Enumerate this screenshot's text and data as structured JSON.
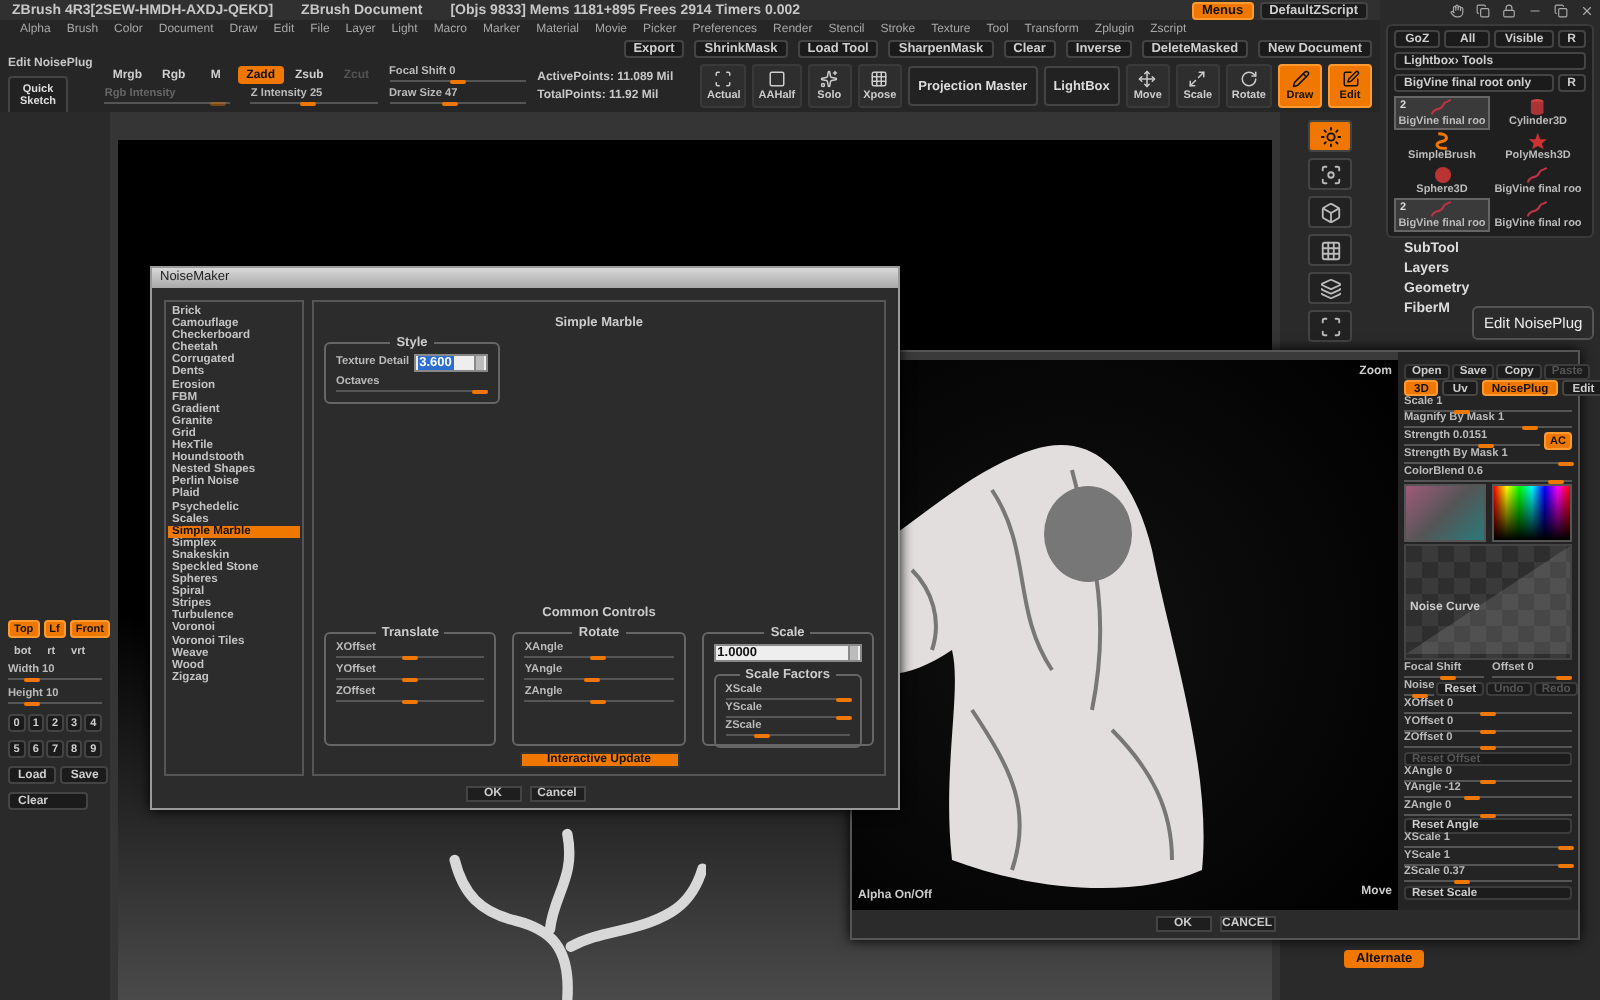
{
  "title_bar": {
    "app": "ZBrush 4R3[2SEW-HMDH-AXDJ-QEKD]",
    "document": "ZBrush Document",
    "stats": "[Objs 9833] Mems 1181+895 Frees 2914 Timers 0.002",
    "buttons": [
      {
        "label": "Menus",
        "selected": true
      },
      {
        "label": "DefaultZScript",
        "selected": false
      }
    ]
  },
  "menu": [
    "Alpha",
    "Brush",
    "Color",
    "Document",
    "Draw",
    "Edit",
    "File",
    "Layer",
    "Light",
    "Macro",
    "Marker",
    "Material",
    "Movie",
    "Picker",
    "Preferences",
    "Render",
    "Stencil",
    "Stroke",
    "Texture",
    "Tool",
    "Transform",
    "Zplugin",
    "Zscript"
  ],
  "toolbar": [
    "Export",
    "ShrinkMask",
    "Load Tool",
    "SharpenMask",
    "Clear",
    "Inverse",
    "DeleteMasked",
    "New Document"
  ],
  "shelf": {
    "edit_label": "Edit NoisePlug",
    "quick_sketch": "Quick Sketch",
    "modes": [
      {
        "label": "Mrgb",
        "selected": false,
        "disabled": false
      },
      {
        "label": "Rgb",
        "selected": false,
        "disabled": false
      },
      {
        "label": "M",
        "selected": false,
        "disabled": false
      },
      {
        "label": "Zadd",
        "selected": true,
        "disabled": false
      },
      {
        "label": "Zsub",
        "selected": false,
        "disabled": false
      },
      {
        "label": "Zcut",
        "selected": false,
        "disabled": true
      }
    ],
    "sliders": [
      {
        "label": "Rgb Intensity",
        "level": 0.9,
        "disabled": true
      },
      {
        "label": "Z Intensity 25",
        "level": 0.45,
        "disabled": false
      },
      {
        "label": "Focal Shift 0",
        "level": 0.5,
        "disabled": false
      },
      {
        "label": "Draw Size 47",
        "level": 0.45,
        "disabled": false
      }
    ],
    "points": [
      "ActivePoints: 11.089 Mil",
      "TotalPoints: 11.92 Mil"
    ],
    "tools": [
      {
        "label": "Actual",
        "kind": "icon",
        "selected": false
      },
      {
        "label": "AAHalf",
        "kind": "icon",
        "selected": false
      },
      {
        "label": "Solo",
        "kind": "icon",
        "selected": false
      },
      {
        "label": "Xpose",
        "kind": "icon",
        "selected": false
      },
      {
        "label": "Projection Master",
        "kind": "text",
        "selected": false
      },
      {
        "label": "LightBox",
        "kind": "text",
        "selected": false
      },
      {
        "label": "Move",
        "kind": "icon",
        "selected": false
      },
      {
        "label": "Scale",
        "kind": "icon",
        "selected": false
      },
      {
        "label": "Rotate",
        "kind": "icon",
        "selected": false
      },
      {
        "label": "Draw",
        "kind": "icon",
        "selected": true
      },
      {
        "label": "Edit",
        "kind": "icon",
        "selected": true
      }
    ]
  },
  "left_strip": {
    "views": [
      {
        "label": "Top",
        "selected": true
      },
      {
        "label": "Lf",
        "selected": true
      },
      {
        "label": "Front",
        "selected": true
      }
    ],
    "views2": [
      "bot",
      "rt",
      "vrt"
    ],
    "sliders": [
      {
        "label": "Width 10",
        "level": 0.25
      },
      {
        "label": "Height 10",
        "level": 0.25
      }
    ],
    "digits": [
      "0",
      "1",
      "2",
      "3",
      "4",
      "5",
      "6",
      "7",
      "8",
      "9"
    ],
    "actions": [
      "Load",
      "Save"
    ],
    "clear": "Clear"
  },
  "right_shelf": [
    {
      "selected": true
    },
    {
      "selected": false
    },
    {
      "selected": false
    },
    {
      "selected": false
    },
    {
      "selected": false
    },
    {
      "selected": false
    }
  ],
  "right_panel": {
    "row": [
      "GoZ",
      "All",
      "Visible",
      "R"
    ],
    "lightbox": "Lightbox› Tools",
    "current_tool": "BigVine final root only",
    "current_r": "R",
    "tools": [
      {
        "label": "BigVine final roo",
        "kind": "vine",
        "badge": "2",
        "selected": true
      },
      {
        "label": "Cylinder3D",
        "kind": "cylinder",
        "selected": false
      },
      {
        "label": "SimpleBrush",
        "kind": "brush",
        "selected": false
      },
      {
        "label": "PolyMesh3D",
        "kind": "star",
        "selected": false
      },
      {
        "label": "Sphere3D",
        "kind": "sphere",
        "selected": false
      },
      {
        "label": "BigVine final roo",
        "kind": "vine",
        "selected": false
      },
      {
        "label": "BigVine final roo",
        "kind": "vine",
        "badge": "2",
        "selected": true
      },
      {
        "label": "BigVine final roo",
        "kind": "vine",
        "selected": false
      }
    ],
    "sections": [
      "SubTool",
      "Layers",
      "Geometry",
      "FiberM"
    ],
    "tooltip": "Edit NoisePlug",
    "alternate": "Alternate"
  },
  "noise_maker": {
    "title": "NoiseMaker",
    "presets": [
      {
        "label": "Brick",
        "selected": false
      },
      {
        "label": "Camouflage",
        "selected": false
      },
      {
        "label": "Checkerboard",
        "selected": false
      },
      {
        "label": "Cheetah",
        "selected": false
      },
      {
        "label": "Corrugated",
        "selected": false
      },
      {
        "label": "Dents",
        "selected": false
      },
      {
        "label": "Erosion",
        "selected": false
      },
      {
        "label": "FBM",
        "selected": false
      },
      {
        "label": "Gradient",
        "selected": false
      },
      {
        "label": "Granite",
        "selected": false
      },
      {
        "label": "Grid",
        "selected": false
      },
      {
        "label": "HexTile",
        "selected": false
      },
      {
        "label": "Houndstooth",
        "selected": false
      },
      {
        "label": "Nested Shapes",
        "selected": false
      },
      {
        "label": "Perlin Noise",
        "selected": false
      },
      {
        "label": "Plaid",
        "selected": false
      },
      {
        "label": "Psychedelic",
        "selected": false
      },
      {
        "label": "Scales",
        "selected": false
      },
      {
        "label": "Simple Marble",
        "selected": true
      },
      {
        "label": "Simplex",
        "selected": false
      },
      {
        "label": "Snakeskin",
        "selected": false
      },
      {
        "label": "Speckled Stone",
        "selected": false
      },
      {
        "label": "Spheres",
        "selected": false
      },
      {
        "label": "Spiral",
        "selected": false
      },
      {
        "label": "Stripes",
        "selected": false
      },
      {
        "label": "Turbulence",
        "selected": false
      },
      {
        "label": "Voronoi",
        "selected": false
      },
      {
        "label": "Voronoi Tiles",
        "selected": false
      },
      {
        "label": "Weave",
        "selected": false
      },
      {
        "label": "Wood",
        "selected": false
      },
      {
        "label": "Zigzag",
        "selected": false
      }
    ],
    "panel_title": "Simple Marble",
    "style": {
      "title": "Style",
      "texture_detail_label": "Texture Detail",
      "texture_detail": "3.600",
      "octaves": {
        "label": "Octaves",
        "level": 0.95
      }
    },
    "common_title": "Common Controls",
    "groups": [
      {
        "title": "Translate",
        "sliders": [
          {
            "label": "XOffset",
            "level": 0.5
          },
          {
            "label": "YOffset",
            "level": 0.5
          },
          {
            "label": "ZOffset",
            "level": 0.5
          }
        ]
      },
      {
        "title": "Rotate",
        "sliders": [
          {
            "label": "XAngle",
            "level": 0.5
          },
          {
            "label": "YAngle",
            "level": 0.45
          },
          {
            "label": "ZAngle",
            "level": 0.5
          }
        ]
      }
    ],
    "scale": {
      "title": "Scale",
      "value": "1.0000",
      "factors_title": "Scale Factors",
      "sliders": [
        {
          "label": "XScale",
          "level": 0.95
        },
        {
          "label": "YScale",
          "level": 0.95
        },
        {
          "label": "ZScale",
          "level": 0.3
        }
      ]
    },
    "interactive_update": {
      "label": "Interactive Update",
      "on": true
    },
    "buttons": [
      "OK",
      "Cancel"
    ]
  },
  "noise_plug": {
    "zoom": "Zoom",
    "file_buttons": [
      {
        "label": "Open",
        "disabled": false
      },
      {
        "label": "Save",
        "disabled": false
      },
      {
        "label": "Copy",
        "disabled": false
      },
      {
        "label": "Paste",
        "disabled": true
      }
    ],
    "modes": [
      {
        "label": "3D",
        "selected": true
      },
      {
        "label": "Uv",
        "selected": false
      },
      {
        "label": "NoisePlug",
        "selected": true
      },
      {
        "label": "Edit",
        "selected": false
      }
    ],
    "sliders": [
      {
        "label": "Scale 1",
        "level": 0.35
      },
      {
        "label": "Magnify By Mask 1",
        "level": 0.75
      },
      {
        "label": "Strength 0.0151",
        "level": 0.6
      },
      {
        "label": "Strength By Mask 1",
        "level": 0.97
      },
      {
        "label": "ColorBlend 0.6",
        "level": 0.9
      }
    ],
    "ac": {
      "label": "AC",
      "on": true
    },
    "noise_curve": "Noise Curve",
    "focal_shift": {
      "label": "Focal Shift",
      "level": 0.55
    },
    "offset": {
      "label": "Offset 0",
      "level": 0.9
    },
    "noise": {
      "label": "Noise",
      "level": 0.5
    },
    "curve_buttons": [
      {
        "label": "Reset",
        "disabled": false
      },
      {
        "label": "Undo",
        "disabled": true
      },
      {
        "label": "Redo",
        "disabled": true
      }
    ],
    "transform": [
      {
        "kind": "slider",
        "label": "XOffset 0",
        "level": 0.5
      },
      {
        "kind": "slider",
        "label": "YOffset 0",
        "level": 0.5
      },
      {
        "kind": "slider",
        "label": "ZOffset 0",
        "level": 0.5
      },
      {
        "kind": "button",
        "label": "Reset Offset",
        "disabled": true
      },
      {
        "kind": "slider",
        "label": "XAngle 0",
        "level": 0.5
      },
      {
        "kind": "slider",
        "label": "YAngle -12",
        "level": 0.4
      },
      {
        "kind": "slider",
        "label": "ZAngle 0",
        "level": 0.5
      },
      {
        "kind": "button",
        "label": "Reset Angle",
        "disabled": false
      },
      {
        "kind": "slider",
        "label": "XScale 1",
        "level": 0.97
      },
      {
        "kind": "slider",
        "label": "YScale 1",
        "level": 0.97
      },
      {
        "kind": "slider",
        "label": "ZScale 0.37",
        "level": 0.35
      },
      {
        "kind": "button",
        "label": "Reset Scale",
        "disabled": false
      }
    ],
    "move": "Move",
    "alpha": "Alpha On/Off",
    "buttons": [
      "OK",
      "CANCEL"
    ]
  }
}
